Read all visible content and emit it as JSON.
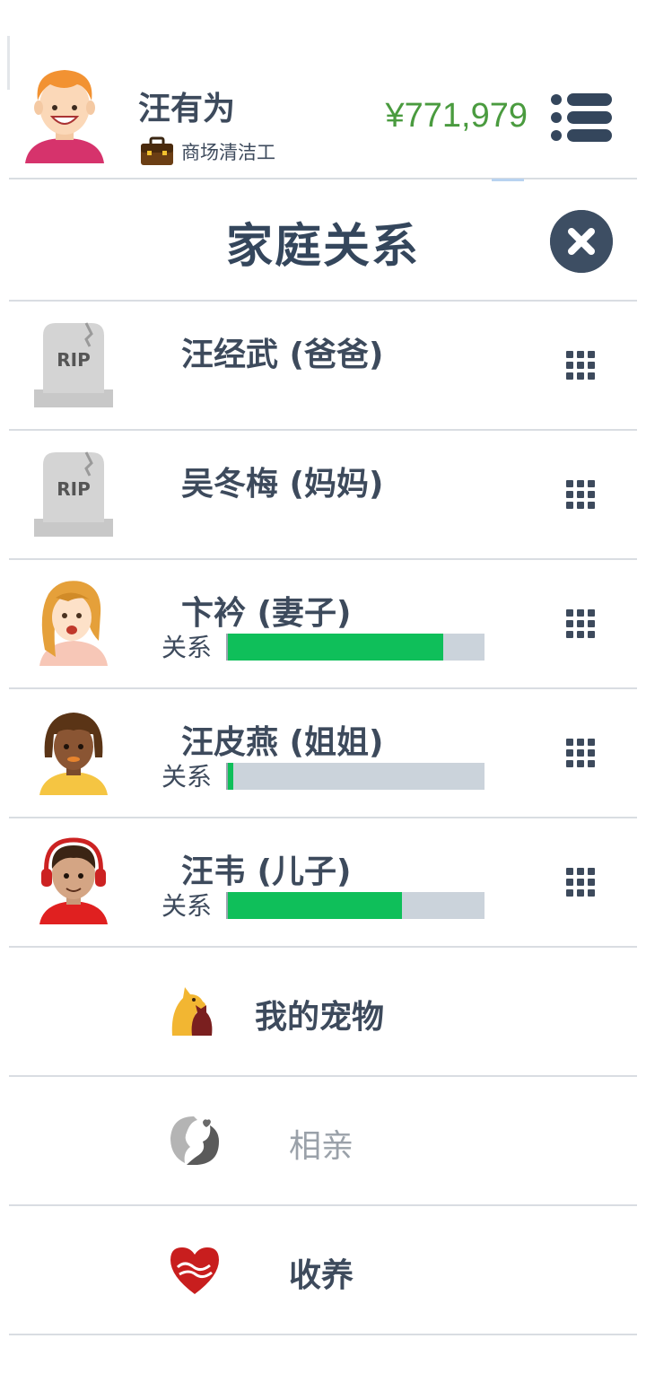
{
  "header": {
    "player_name": "汪有为",
    "job": "商场清洁工",
    "money": "¥771,979"
  },
  "title": "家庭关系",
  "relationship_label": "关系",
  "family": [
    {
      "name": "汪经武 (爸爸)",
      "status": "deceased",
      "icon": "tombstone-rip-icon",
      "tombstone_text": "RIP"
    },
    {
      "name": "吴冬梅 (妈妈)",
      "status": "deceased",
      "icon": "tombstone-rip-icon",
      "tombstone_text": "RIP"
    },
    {
      "name": "卞衿 (妻子)",
      "status": "alive",
      "icon": "wife-avatar-icon",
      "relationship": 0.84
    },
    {
      "name": "汪皮燕 (姐姐)",
      "status": "alive",
      "icon": "sister-avatar-icon",
      "relationship": 0.02
    },
    {
      "name": "汪韦 (儿子)",
      "status": "alive",
      "icon": "son-avatar-icon",
      "relationship": 0.68
    }
  ],
  "actions": [
    {
      "label": "我的宠物",
      "icon": "pet-icon",
      "enabled": true
    },
    {
      "label": "相亲",
      "icon": "dating-icon",
      "enabled": false
    },
    {
      "label": "收养",
      "icon": "adoption-heart-icon",
      "enabled": true
    }
  ],
  "colors": {
    "money": "#4a9b3f",
    "relationship_fill": "#0fbf5a",
    "relationship_track": "#cbd3db",
    "close_button": "#3d4e63"
  }
}
